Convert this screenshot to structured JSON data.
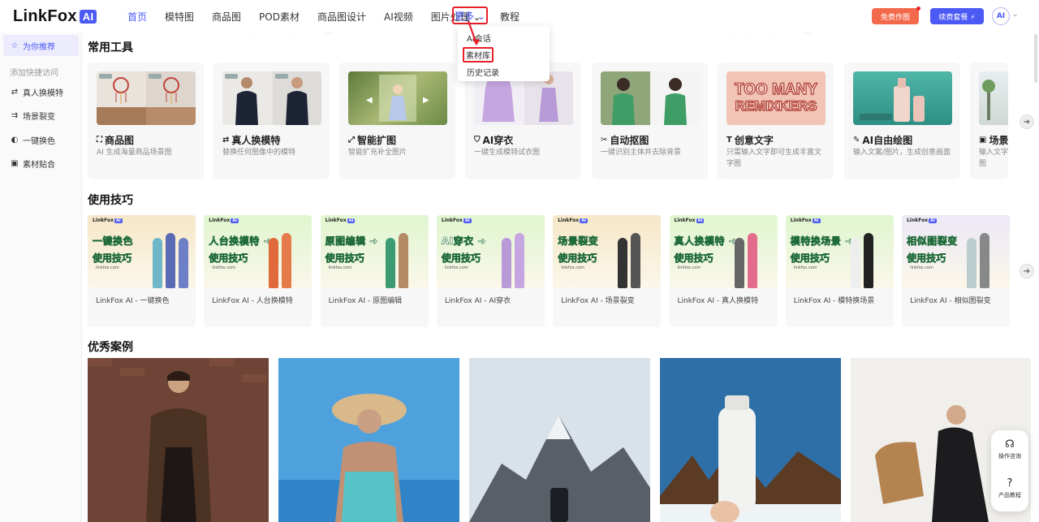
{
  "header": {
    "logo_text": "LinkFox",
    "logo_badge": "AI",
    "nav": [
      {
        "label": "首页",
        "active": true
      },
      {
        "label": "模特图"
      },
      {
        "label": "商品图"
      },
      {
        "label": "POD素材"
      },
      {
        "label": "商品图设计"
      },
      {
        "label": "AI视频"
      },
      {
        "label": "图片处理 ⌄"
      }
    ],
    "more_label": "更多 ⌄",
    "tutorial_label": "教程",
    "free_button": "免费作图",
    "renew_button": "续费套餐 ⚡",
    "avatar": "AI",
    "avatar_chevron": "⌄"
  },
  "dropdown": {
    "items": [
      "AI会话",
      "素材库",
      "历史记录"
    ],
    "highlighted": "素材库"
  },
  "sidebar": {
    "recommend": "为你推荐",
    "shortcut_hint": "添加快捷访问",
    "items": [
      {
        "label": "真人换模特",
        "icon": "swap-icon"
      },
      {
        "label": "场景裂变",
        "icon": "split-icon"
      },
      {
        "label": "一键换色",
        "icon": "color-icon"
      },
      {
        "label": "素材贴合",
        "icon": "image-icon"
      }
    ]
  },
  "sections": {
    "tools": "常用工具",
    "tips": "使用技巧",
    "cases": "优秀案例"
  },
  "tools": [
    {
      "name": "商品图",
      "icon": "bag-icon",
      "desc": "AI 生成海量商品场景图"
    },
    {
      "name": "真人换模特",
      "icon": "swap-icon",
      "desc": "替换任何图像中的模特"
    },
    {
      "name": "智能扩图",
      "icon": "expand-icon",
      "desc": "智能扩充补全图片"
    },
    {
      "name": "AI穿衣",
      "icon": "shirt-icon",
      "desc": "一键生成模特试衣图"
    },
    {
      "name": "自动抠图",
      "icon": "cutout-icon",
      "desc": "一键识别主体并去除背景"
    },
    {
      "name": "创意文字",
      "icon": "text-icon",
      "desc": "只需输入文字即可生成丰富文字图"
    },
    {
      "name": "AI自由绘图",
      "icon": "pencil-icon",
      "desc": "输入文案/图片，生成创意画面"
    },
    {
      "name": "场景",
      "icon": "image-icon",
      "desc": "输入文字图"
    }
  ],
  "tool_thumb_text": {
    "remix_line1": "TOO MANY",
    "remix_line2": "REMIXKERS"
  },
  "tips": [
    {
      "label": "LinkFox AI - 一键换色",
      "headline": "一键换色",
      "sub": "使用技巧"
    },
    {
      "label": "LinkFox AI - 人台换模特",
      "headline": "人台换模特 ➜",
      "sub": "使用技巧"
    },
    {
      "label": "LinkFox AI - 原图编辑",
      "headline": "原图编辑 ➜",
      "sub": "使用技巧"
    },
    {
      "label": "LinkFox AI - AI穿衣",
      "headline": "AI穿衣 ➜",
      "sub": "使用技巧"
    },
    {
      "label": "LinkFox AI - 场景裂变",
      "headline": "场景裂变",
      "sub": "使用技巧"
    },
    {
      "label": "LinkFox AI - 真人换模特",
      "headline": "真人换模特 ➜",
      "sub": "使用技巧"
    },
    {
      "label": "LinkFox AI - 模特换场景",
      "headline": "模特换场景 ➜",
      "sub": "使用技巧"
    },
    {
      "label": "LinkFox AI - 相似图裂变",
      "headline": "相似图裂变",
      "sub": "使用技巧"
    }
  ],
  "tip_brand": "LinkFox",
  "tip_brand_badge": "AI",
  "tip_site": "linkfox.com",
  "float_panel": {
    "consult": "操作咨询",
    "tutorial": "产品教程"
  },
  "colors": {
    "brand": "#4b59f5",
    "highlight_red": "#e8202a",
    "free_button": "#f26a4b"
  }
}
